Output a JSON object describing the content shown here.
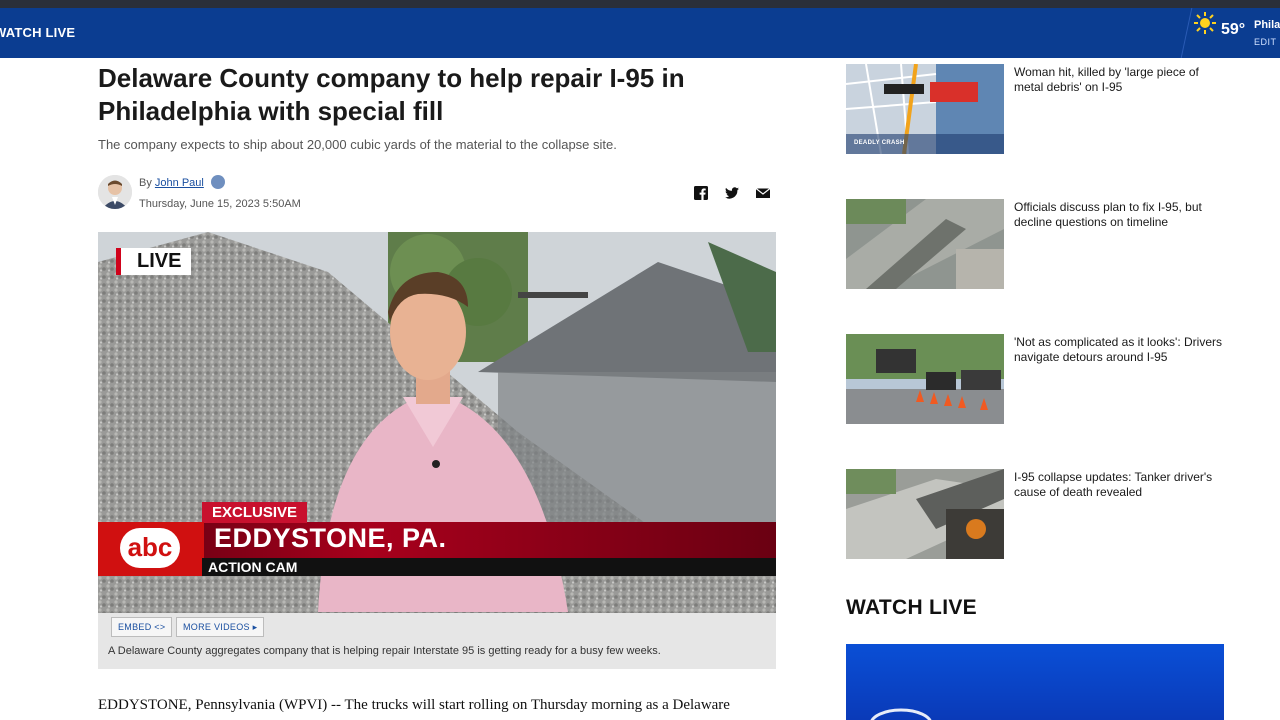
{
  "nav": {
    "watch_live": "WATCH LIVE",
    "weather": {
      "temp": "59°",
      "city": "Philadelphia",
      "edit": "EDIT",
      "icon": "sun-icon"
    }
  },
  "article": {
    "headline": "Delaware County company to help repair I-95 in Philadelphia with special fill",
    "subhead": "The company expects to ship about 20,000 cubic yards of the material to the collapse site.",
    "by": "By",
    "author": "John Paul",
    "date": "Thursday, June 15, 2023 5:50AM",
    "share_icons": [
      "facebook-icon",
      "twitter-icon",
      "email-icon"
    ],
    "body_first_line": "EDDYSTONE, Pennsylvania (WPVI) -- The trucks will start rolling on Thursday morning as a Delaware"
  },
  "video": {
    "live_badge": "LIVE",
    "exclusive": "EXCLUSIVE",
    "location": "EDDYSTONE, PA.",
    "action_cam": "ACTION CAM",
    "logo": "abc",
    "embed_label": "EMBED <>",
    "more_videos_label": "MORE VIDEOS ▸",
    "caption": "A Delaware County aggregates company that is helping repair Interstate 95 is getting ready for a busy few weeks."
  },
  "rail": {
    "items": [
      {
        "title": "Woman hit, killed by 'large piece of metal debris' on I-95",
        "tag": "DEADLY CRASH"
      },
      {
        "title": "Officials discuss plan to fix I-95, but decline questions on timeline"
      },
      {
        "title": "'Not as complicated as it looks': Drivers navigate detours around I-95"
      },
      {
        "title": "I-95 collapse updates: Tanker driver's cause of death revealed"
      }
    ],
    "watch_live_heading": "WATCH LIVE"
  },
  "colors": {
    "nav_blue": "#0b3d91",
    "abc_red": "#d01010",
    "link_blue": "#1a4fa0",
    "watch_blue": "#0a4fd6"
  }
}
